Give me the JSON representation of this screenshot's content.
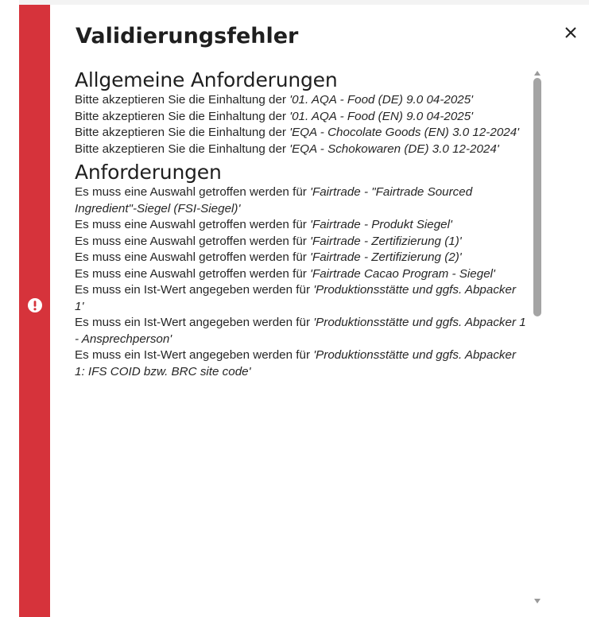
{
  "dialog": {
    "title": "Validierungsfehler",
    "close_label": "×",
    "accent_color": "#d6333b"
  },
  "sections": [
    {
      "heading": "Allgemeine Anforderungen",
      "items": [
        {
          "prefix": "Bitte akzeptieren Sie die Einhaltung der ",
          "name": "'01. AQA - Food (DE) 9.0 04-2025'"
        },
        {
          "prefix": "Bitte akzeptieren Sie die Einhaltung der ",
          "name": "'01. AQA - Food (EN) 9.0 04-2025'"
        },
        {
          "prefix": "Bitte akzeptieren Sie die Einhaltung der ",
          "name": "'EQA - Chocolate Goods (EN) 3.0 12-2024'"
        },
        {
          "prefix": "Bitte akzeptieren Sie die Einhaltung der ",
          "name": "'EQA - Schokowaren (DE) 3.0 12-2024'"
        }
      ]
    },
    {
      "heading": "Anforderungen",
      "items": [
        {
          "prefix": "Es muss eine Auswahl getroffen werden für ",
          "name": "'Fairtrade - \"Fairtrade Sourced Ingredient\"-Siegel (FSI-Siegel)'"
        },
        {
          "prefix": "Es muss eine Auswahl getroffen werden für ",
          "name": "'Fairtrade - Produkt Siegel'"
        },
        {
          "prefix": "Es muss eine Auswahl getroffen werden für ",
          "name": "'Fairtrade - Zertifizierung (1)'"
        },
        {
          "prefix": "Es muss eine Auswahl getroffen werden für ",
          "name": "'Fairtrade - Zertifizierung (2)'"
        },
        {
          "prefix": "Es muss eine Auswahl getroffen werden für ",
          "name": "'Fairtrade Cacao Program - Siegel'"
        },
        {
          "prefix": "Es muss ein Ist-Wert angegeben werden für ",
          "name": "'Produktionsstätte und ggfs. Abpacker 1'"
        },
        {
          "prefix": "Es muss ein Ist-Wert angegeben werden für ",
          "name": "'Produktionsstätte und ggfs. Abpacker 1 - Ansprechperson'"
        },
        {
          "prefix": "Es muss ein Ist-Wert angegeben werden für ",
          "name": "'Produktionsstätte und ggfs. Abpacker 1: IFS COID bzw. BRC site code'"
        }
      ]
    }
  ],
  "icons": {
    "alert": "exclamation-circle-icon",
    "close": "close-icon",
    "scroll_up": "triangle-up-icon",
    "scroll_down": "triangle-down-icon"
  }
}
